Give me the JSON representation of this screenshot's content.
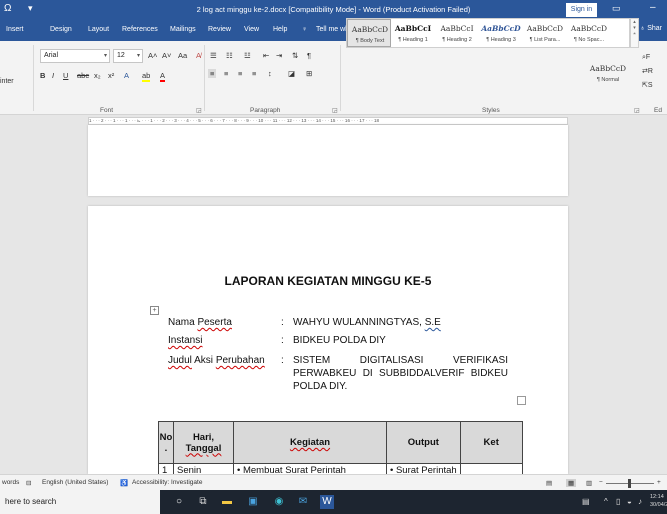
{
  "titlebar": {
    "qa_icon": "save-icon",
    "qa_more": "▾",
    "title": "2 log act minggu ke-2.docx [Compatibility Mode] - Word (Product Activation Failed)",
    "signin": "Sign in",
    "ribbon_display_icon": "ribbon-display-icon",
    "minimize": "–"
  },
  "menu": {
    "tabs": [
      "Insert",
      "Design",
      "Layout",
      "References",
      "Mailings",
      "Review",
      "View",
      "Help"
    ],
    "tell_me": "Tell me what you want to do",
    "share": "Shar"
  },
  "ribbon": {
    "painter_label": "inter",
    "font_name": "Arial",
    "font_size": "12",
    "grow_font": "A˄",
    "shrink_font": "A˅",
    "change_case": "Aa",
    "clear_format": "A̸",
    "bold": "B",
    "italic": "I",
    "underline": "U",
    "strike": "abc",
    "subscript": "x₂",
    "superscript": "x²",
    "text_effects": "A",
    "highlight": "ab",
    "font_color": "A",
    "font_group": "Font",
    "paragraph_group": "Paragraph",
    "styles_group": "Styles",
    "editing_group": "Ed",
    "styles": [
      {
        "preview": "AaBbCcD",
        "name": "¶ Body Text",
        "kind": "normal"
      },
      {
        "preview": "AaBbCcI",
        "name": "¶ Heading 1",
        "kind": "heading"
      },
      {
        "preview": "AaBbCcI",
        "name": "¶ Heading 2",
        "kind": "normal"
      },
      {
        "preview": "AaBbCcD",
        "name": "¶ Heading 3",
        "kind": "italic"
      },
      {
        "preview": "AaBbCcD",
        "name": "¶ List Para...",
        "kind": "normal"
      },
      {
        "preview": "AaBbCcD",
        "name": "¶ No Spac...",
        "kind": "normal"
      },
      {
        "preview": "AaBbCcD",
        "name": "¶ Normal",
        "kind": "normal"
      }
    ],
    "editing": [
      "F",
      "R",
      "S"
    ]
  },
  "ruler": {
    "text": "1 · · · 2 · · · 1 · · · 1 · · · ⊾ · · · 1 · · · 2 · · · 3 · · · 4 · · · 5 · · · 6 · · · 7 · · · 8 · · · 9 · · · 10 · · · 11 · · · 12 · · · 13 · · · 14 · · · 15 · · · 16 · · · 17 · · · 18"
  },
  "document": {
    "heading": "LAPORAN KEGIATAN MINGGU KE-5",
    "fields": [
      {
        "label_a": "Nama ",
        "label_b": "Peserta",
        "colon": ":",
        "value_a": "WAHYU WULANNINGTYAS, ",
        "value_b": "S.E"
      },
      {
        "label_a": "",
        "label_b": "Instansi",
        "colon": ":",
        "value_a": "BIDKEU POLDA DIY",
        "value_b": ""
      },
      {
        "label_a": "",
        "label_b": "Judul",
        "label_c": " Aksi ",
        "label_d": "Perubahan",
        "colon": ":"
      }
    ],
    "judul_lines": [
      "SISTEM DIGITALISASI VERIFIKASI",
      "PERWABKEU DI SUBBIDDALVERIF BIDKEU",
      "POLDA DIY."
    ],
    "table": {
      "headers": {
        "no": "No",
        "no_dot": ".",
        "hari_1": "Hari,",
        "hari_2": "Tanggal",
        "kegiatan": "Kegiatan",
        "output": "Output",
        "ket": "Ket"
      },
      "row1": {
        "no": "1",
        "hari": "Senin",
        "kegiatan": "• Membuat Surat Perintah",
        "output": "• Surat Perintah",
        "ket": ""
      }
    }
  },
  "statusbar": {
    "words": "words",
    "language": "English (United States)",
    "accessibility": "Accessibility: Investigate",
    "zoom_minus": "−",
    "zoom_plus": "+"
  },
  "taskbar": {
    "search": "here to search",
    "time": "12:14",
    "date": "30/04/2"
  },
  "colors": {
    "word_blue": "#2b579a",
    "table_header": "#d9d9d9",
    "spell_error": "#c00000"
  }
}
